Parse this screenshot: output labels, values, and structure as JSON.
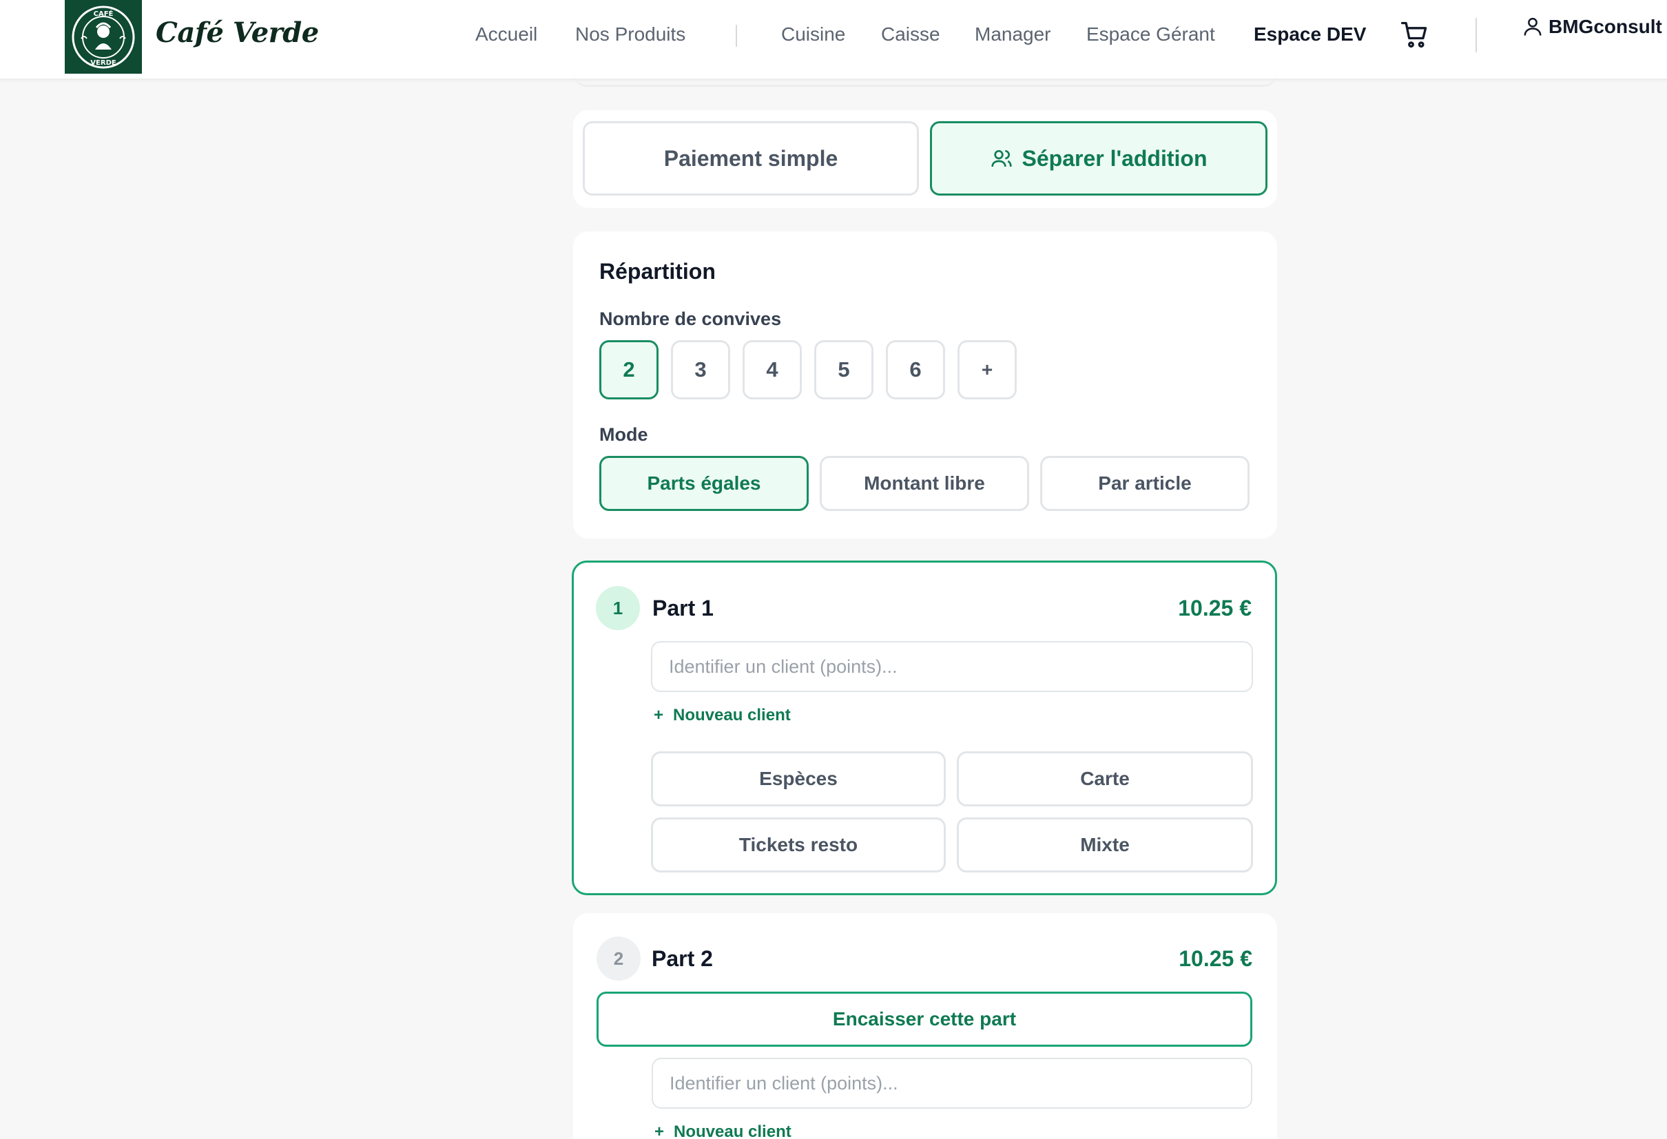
{
  "header": {
    "brand": "Café Verde",
    "logo_text_top": "CAFÉ",
    "logo_text_bottom": "VERDE",
    "nav": [
      {
        "label": "Accueil"
      },
      {
        "label": "Nos Produits"
      },
      {
        "label": "Cuisine"
      },
      {
        "label": "Caisse"
      },
      {
        "label": "Manager"
      },
      {
        "label": "Espace Gérant"
      },
      {
        "label": "Espace DEV",
        "active": true
      }
    ],
    "user": "BMGconsult",
    "icons": {
      "cart": "cart-icon",
      "user": "user-icon"
    }
  },
  "payment_mode": {
    "simple_label": "Paiement simple",
    "split_label": "Séparer l'addition",
    "selected": "split"
  },
  "repartition": {
    "title": "Répartition",
    "guests_label": "Nombre de convives",
    "guest_options": [
      "2",
      "3",
      "4",
      "5",
      "6",
      "+"
    ],
    "guest_selected": "2",
    "mode_label": "Mode",
    "modes": [
      "Parts égales",
      "Montant libre",
      "Par article"
    ],
    "mode_selected": "Parts égales"
  },
  "parts": [
    {
      "number": "1",
      "title": "Part 1",
      "amount": "10.25 €",
      "client_placeholder": "Identifier un client (points)...",
      "new_client": "Nouveau client",
      "methods": [
        "Espèces",
        "Carte",
        "Tickets resto",
        "Mixte"
      ]
    },
    {
      "number": "2",
      "title": "Part 2",
      "amount": "10.25 €",
      "collect_label": "Encaisser cette part",
      "client_placeholder": "Identifier un client (points)...",
      "new_client": "Nouveau client"
    }
  ],
  "colors": {
    "accent": "#0f7a53",
    "accent_bg": "#ecfbf3",
    "border_highlight": "#1aa574",
    "logo_bg": "#0f4a32"
  }
}
